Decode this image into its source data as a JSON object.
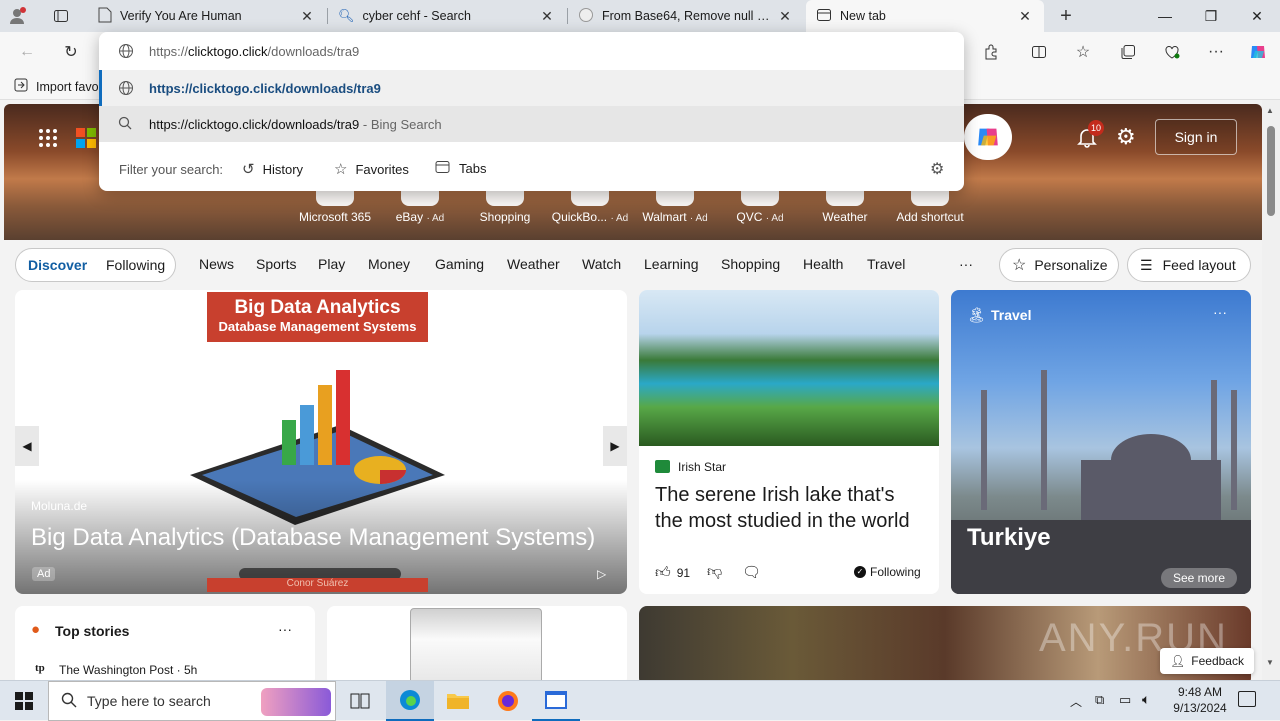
{
  "tabs": [
    {
      "title": "Verify You Are Human",
      "icon": "page-icon"
    },
    {
      "title": "cyber cehf - Search",
      "icon": "search-icon"
    },
    {
      "title": "From Base64, Remove null bytes - C",
      "icon": "chef-icon"
    },
    {
      "title": "New tab",
      "icon": "newtab-icon"
    }
  ],
  "address": {
    "prefix": "https://",
    "host": "clicktogo.click",
    "path": "/downloads/tra9"
  },
  "omnibox": {
    "suggestion1": "https://clicktogo.click/downloads/tra9",
    "suggestion2": "https://clicktogo.click/downloads/tra9",
    "suggestion2_suffix": " - Bing Search",
    "filter_label": "Filter your search:",
    "filters": [
      "History",
      "Favorites",
      "Tabs"
    ]
  },
  "favbar": {
    "import_label": "Import favo"
  },
  "hero": {
    "sign_in": "Sign in",
    "notif_count": "10",
    "quicklinks": [
      {
        "label": "Microsoft 365",
        "ad": ""
      },
      {
        "label": "eBay",
        "ad": "· Ad"
      },
      {
        "label": "Shopping",
        "ad": ""
      },
      {
        "label": "QuickBo...",
        "ad": "· Ad"
      },
      {
        "label": "Walmart",
        "ad": "· Ad"
      },
      {
        "label": "QVC",
        "ad": "· Ad"
      },
      {
        "label": "Weather",
        "ad": ""
      },
      {
        "label": "Add shortcut",
        "ad": ""
      }
    ]
  },
  "nav": {
    "discover": "Discover",
    "following": "Following",
    "items": [
      "News",
      "Sports",
      "Play",
      "Money",
      "Gaming",
      "Weather",
      "Watch",
      "Learning",
      "Shopping",
      "Health",
      "Travel"
    ],
    "more": "···",
    "personalize": "Personalize",
    "feed_layout": "Feed layout"
  },
  "card_main": {
    "banner_line1": "Big Data Analytics",
    "banner_line2": "Database Management Systems",
    "source": "Moluna.de",
    "title": "Big Data Analytics (Database Management Systems)",
    "ad": "Ad",
    "author": "Conor Suárez"
  },
  "card_irish": {
    "source": "Irish Star",
    "title": "The serene Irish lake that's the most studied in the world",
    "likes": "91",
    "following": "Following"
  },
  "card_travel": {
    "category": "Travel",
    "place": "Turkiye",
    "see_more": "See more"
  },
  "top_stories": {
    "title": "Top stories",
    "source": "The Washington Post · 5h"
  },
  "feedback": "Feedback",
  "watermark": "ANY.RUN",
  "taskbar": {
    "search_placeholder": "Type here to search",
    "time": "9:48 AM",
    "date": "9/13/2024"
  }
}
